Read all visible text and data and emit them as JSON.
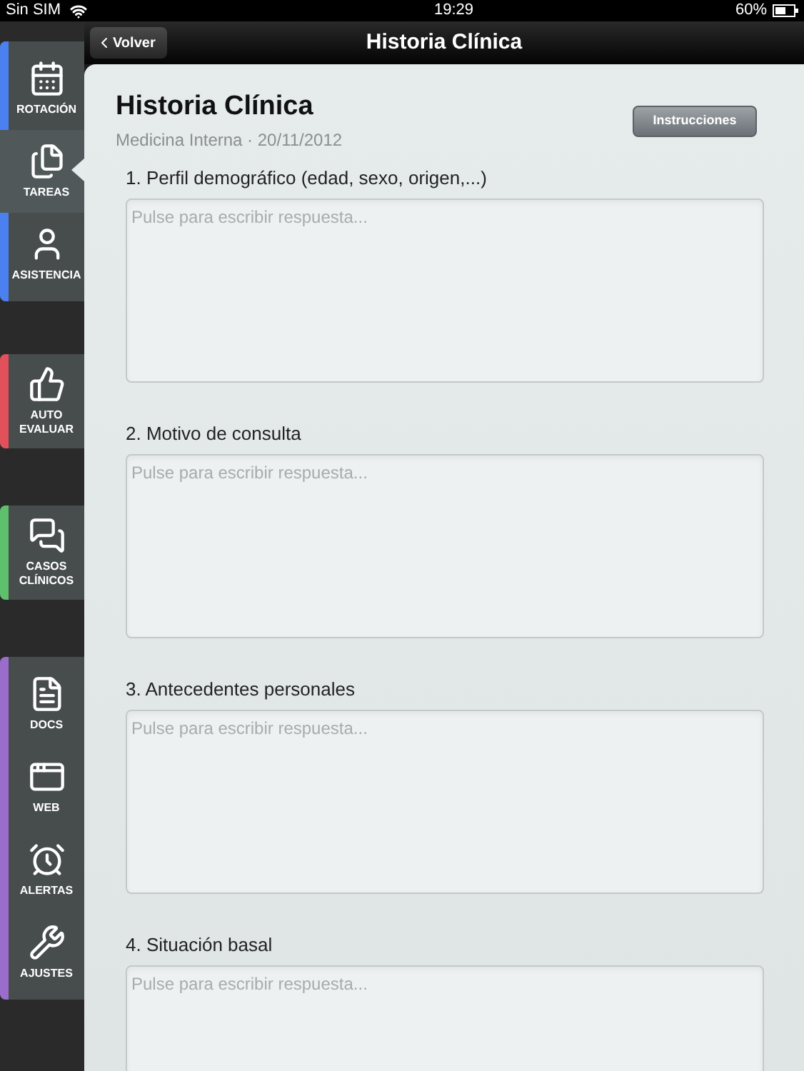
{
  "status_bar": {
    "carrier": "Sin SIM",
    "time": "19:29",
    "battery": "60%"
  },
  "nav_bar": {
    "back": "Volver",
    "title": "Historia Clínica"
  },
  "sidebar": {
    "groups": [
      {
        "color": "#4a80f0",
        "items": [
          {
            "label": "ROTACIÓN",
            "selected": false
          },
          {
            "label": "TAREAS",
            "selected": true
          },
          {
            "label": "ASISTENCIA",
            "selected": false
          }
        ]
      },
      {
        "color": "#e2505a",
        "items": [
          {
            "label": "AUTO EVALUAR",
            "selected": false
          }
        ]
      },
      {
        "color": "#5ec06c",
        "items": [
          {
            "label": "CASOS CLÍNICOS",
            "selected": false
          }
        ]
      },
      {
        "color": "#9a6ccc",
        "items": [
          {
            "label": "DOCS",
            "selected": false
          },
          {
            "label": "WEB",
            "selected": false
          },
          {
            "label": "ALERTAS",
            "selected": false
          },
          {
            "label": "AJUSTES",
            "selected": false
          }
        ]
      }
    ]
  },
  "header": {
    "title": "Historia Clínica",
    "subtitle": "Medicina Interna · 20/11/2012",
    "button": "Instrucciones"
  },
  "questions": [
    {
      "label": "1. Perfil demográfico (edad, sexo, origen,...)",
      "placeholder": "Pulse para escribir respuesta..."
    },
    {
      "label": "2. Motivo de consulta",
      "placeholder": "Pulse para escribir respuesta..."
    },
    {
      "label": "3. Antecedentes personales",
      "placeholder": "Pulse para escribir respuesta..."
    },
    {
      "label": "4. Situación basal",
      "placeholder": "Pulse para escribir respuesta..."
    }
  ]
}
